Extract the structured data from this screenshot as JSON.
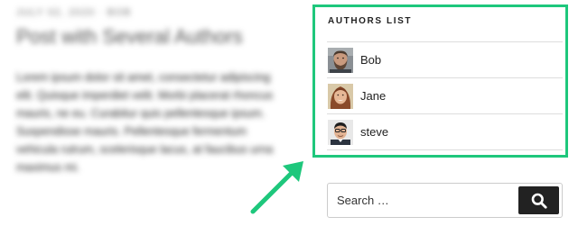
{
  "post": {
    "date": "July 02, 2020 · Bob",
    "title": "Post with Several Authors",
    "body": "Lorem ipsum dolor sit amet, consectetur adipiscing elit. Quisque imperdiet velit. Morbi placerat rhoncus mauris, ne eu. Curabitur quis pellentesque ipsum. Suspendisse mauris. Pellentesque fermentum vehicula rutrum, scelerisque lacus, at faucibus urna maximus mi."
  },
  "authors_widget": {
    "title": "AUTHORS LIST",
    "border_color": "#1ec77c",
    "authors": [
      {
        "name": "Bob",
        "avatar": "bearded-man-avatar"
      },
      {
        "name": "Jane",
        "avatar": "woman-avatar"
      },
      {
        "name": "steve",
        "avatar": "man-with-glasses-avatar"
      }
    ]
  },
  "annotation": {
    "arrow_color": "#1ec77c",
    "arrow_icon": "arrow-up-right-icon"
  },
  "search": {
    "placeholder": "Search …",
    "button_icon": "search-icon",
    "button_color": "#222222"
  }
}
